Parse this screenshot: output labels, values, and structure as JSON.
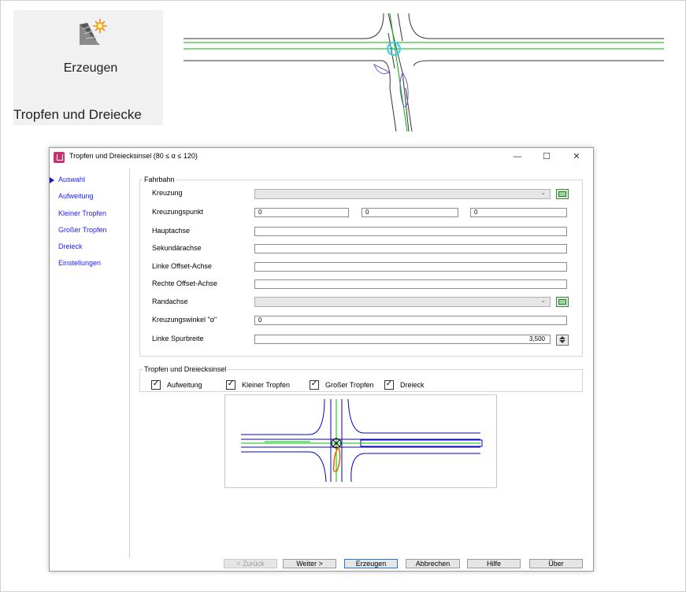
{
  "ribbon": {
    "button_label": "Erzeugen",
    "group_label": "Tropfen und Dreiecke"
  },
  "dialog": {
    "title": "Tropfen und Dreiecksinsel (80 ≤ α ≤ 120)",
    "window_buttons": {
      "minimize": "—",
      "maximize": "☐",
      "close": "✕"
    },
    "nav": [
      "Auswahl",
      "Aufweitung",
      "Kleiner Tropfen",
      "Großer Tropfen",
      "Dreieck",
      "Einstellungen"
    ],
    "fahrbahn": {
      "title": "Fahrbahn",
      "kreuzung_label": "Kreuzung",
      "kreuzungspunkt_label": "Kreuzungspunkt",
      "kreuzungspunkt_values": [
        "0",
        "0",
        "0"
      ],
      "hauptachse_label": "Hauptachse",
      "sekundaerachse_label": "Sekundärachse",
      "linke_offset_label": "Linke Offset-Achse",
      "rechte_offset_label": "Rechte Offset-Achse",
      "randachse_label": "Randachse",
      "kreuzungswinkel_label": "Kreuzungswinkel \"α\"",
      "kreuzungswinkel_value": "0",
      "linke_spurbreite_label": "Linke Spurbreite",
      "linke_spurbreite_value": "3,500"
    },
    "insel": {
      "title": "Tropfen und Dreiecksinsel",
      "options": [
        {
          "label": "Aufweitung",
          "checked": true
        },
        {
          "label": "Kleiner Tropfen",
          "checked": true
        },
        {
          "label": "Großer Tropfen",
          "checked": true
        },
        {
          "label": "Dreieck",
          "checked": true
        }
      ]
    },
    "buttons": {
      "back": "< Zurück",
      "next": "Weiter >",
      "create": "Erzeugen",
      "cancel": "Abbrechen",
      "help": "Hilfe",
      "about": "Über"
    }
  },
  "colors": {
    "nav_link": "#1a1aff",
    "axis_green": "#00c000",
    "road_blue": "#0000cc",
    "drop_orange": "#e07000",
    "app_icon": "#c8326e"
  },
  "icons": {
    "ribbon": "tropfen-dreieck-icon",
    "pick": "select-from-drawing-icon",
    "spin": "spin-updown-icon",
    "combo": "chevron-down-icon"
  }
}
